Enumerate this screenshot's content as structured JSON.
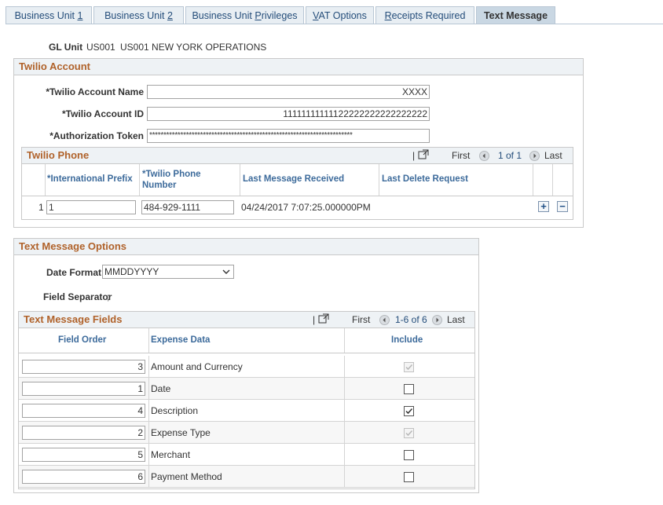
{
  "tabs": [
    {
      "label": "Business Unit ",
      "ul": "1"
    },
    {
      "label": "Business Unit ",
      "ul": "2"
    },
    {
      "label": "Business Unit ",
      "ul": "P",
      "rest": "rivileges"
    },
    {
      "label": "",
      "ul": "V",
      "rest": "AT Options"
    },
    {
      "label": "",
      "ul": "R",
      "rest": "eceipts Required"
    },
    {
      "label": "Text Message",
      "ul": "",
      "rest": ""
    }
  ],
  "gl_unit": {
    "label": "GL Unit",
    "code": "US001",
    "name": "US001 NEW YORK OPERATIONS"
  },
  "twilio_account": {
    "title": "Twilio Account",
    "name_label": "*Twilio Account Name",
    "name_value": "XXXX",
    "id_label": "*Twilio Account ID",
    "id_value": "11111111111122222222222222222",
    "token_label": "*Authorization Token",
    "token_value": "************************************************************************"
  },
  "twilio_phone": {
    "title": "Twilio Phone",
    "nav": {
      "first": "First",
      "count": "1 of 1",
      "last": "Last"
    },
    "columns": [
      "*International Prefix",
      "*Twilio Phone Number",
      "Last Message Received",
      "Last Delete Request"
    ],
    "rows": [
      {
        "num": "1",
        "prefix": "1",
        "phone": "484-929-1111",
        "last_received": "04/24/2017  7:07:25.000000PM",
        "last_delete": ""
      }
    ]
  },
  "text_message_options": {
    "title": "Text Message Options",
    "date_format_label": "Date Format",
    "date_format_value": "MMDDYYYY",
    "separator_label": "Field Separator",
    "separator_value": ";"
  },
  "text_message_fields": {
    "title": "Text Message Fields",
    "nav": {
      "first": "First",
      "count": "1-6 of 6",
      "last": "Last"
    },
    "columns": [
      "Field Order",
      "Expense Data",
      "Include"
    ],
    "rows": [
      {
        "order": "3",
        "data": "Amount and Currency",
        "include": true,
        "disabled": true
      },
      {
        "order": "1",
        "data": "Date",
        "include": false,
        "disabled": false
      },
      {
        "order": "4",
        "data": "Description",
        "include": true,
        "disabled": false
      },
      {
        "order": "2",
        "data": "Expense Type",
        "include": true,
        "disabled": true
      },
      {
        "order": "5",
        "data": "Merchant",
        "include": false,
        "disabled": false
      },
      {
        "order": "6",
        "data": "Payment Method",
        "include": false,
        "disabled": false
      }
    ]
  },
  "colors": {
    "accent": "#b0622a",
    "link": "#244d7a",
    "header_bg": "#eef2f5"
  }
}
